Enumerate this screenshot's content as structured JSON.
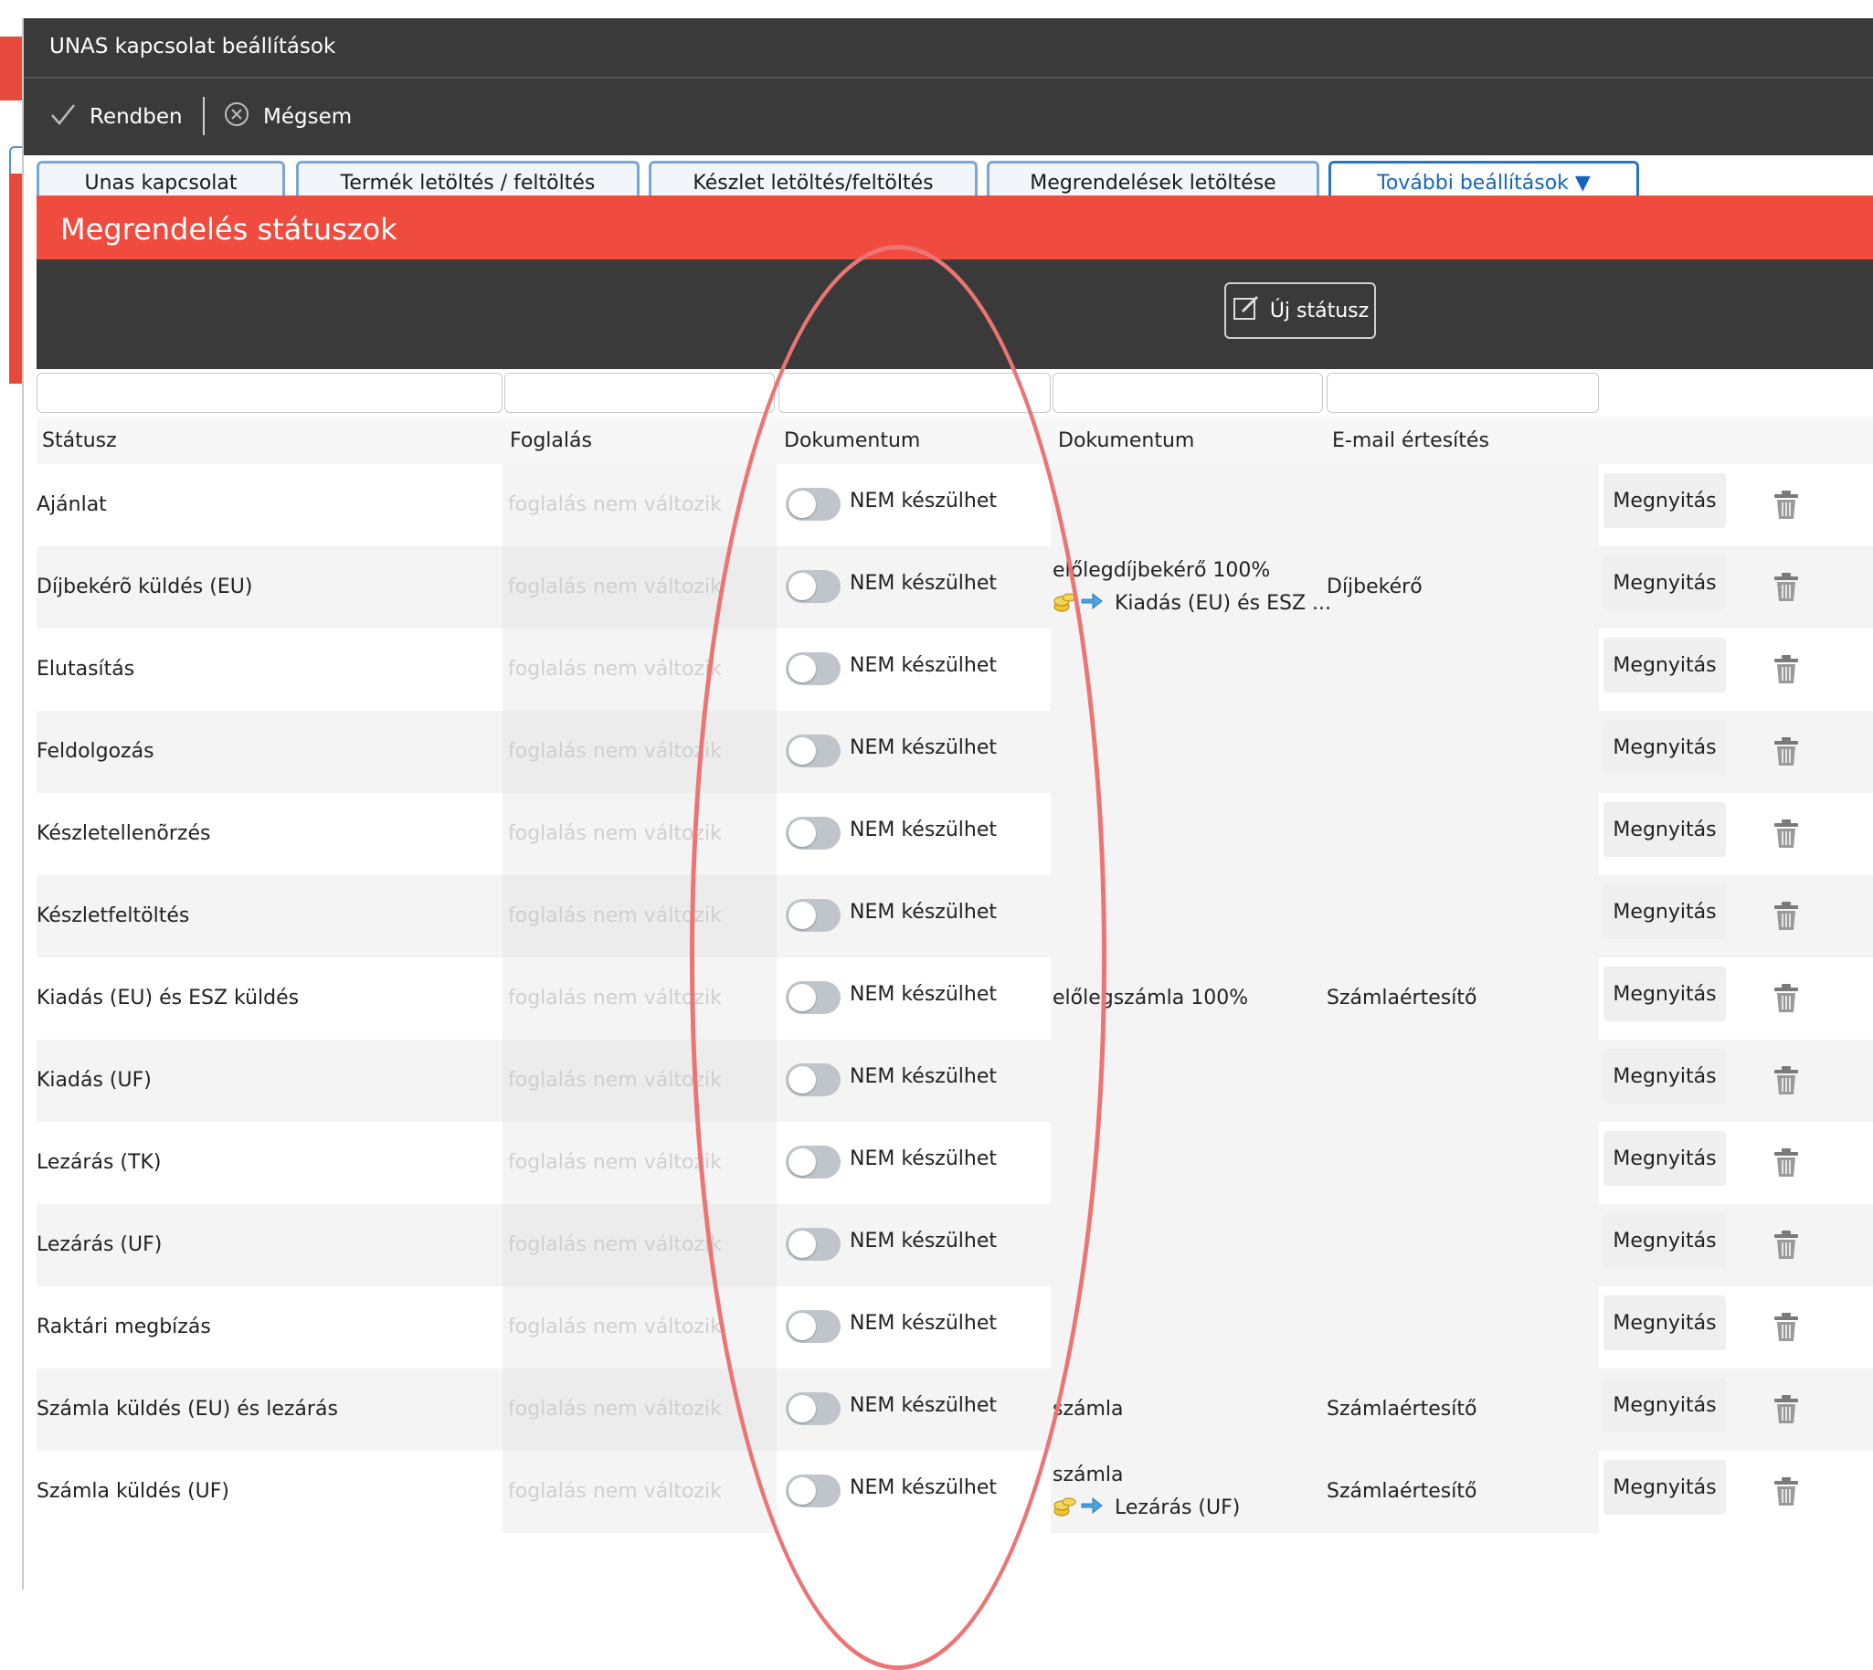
{
  "window": {
    "title": "UNAS kapcsolat beállítások"
  },
  "toolbar": {
    "ok_label": "Rendben",
    "cancel_label": "Mégsem"
  },
  "tabs": [
    {
      "label": "Unas kapcsolat"
    },
    {
      "label": "Termék letöltés / feltöltés"
    },
    {
      "label": "Készlet letöltés/feltöltés"
    },
    {
      "label": "Megrendelések letöltése"
    },
    {
      "label": "További beállítások ▼"
    }
  ],
  "section": {
    "title": "Megrendelés státuszok",
    "new_status_label": "Új státusz"
  },
  "columns": [
    "Státusz",
    "Foglalás",
    "Dokumentum",
    "Dokumentum",
    "E-mail értesítés"
  ],
  "rows": [
    {
      "status": "Ajánlat",
      "foglalas": "foglalás nem változik",
      "toggle": "NEM készülhet",
      "doc": "",
      "doc_next": "",
      "email": "",
      "open": "Megnyitás"
    },
    {
      "status": "Díjbekérõ küldés (EU)",
      "foglalas": "foglalás nem változik",
      "toggle": "NEM készülhet",
      "doc": "előlegdíjbekérő 100%",
      "doc_next": "Kiadás (EU) és ESZ ...",
      "email": "Díjbekérő",
      "open": "Megnyitás"
    },
    {
      "status": "Elutasítás",
      "foglalas": "foglalás nem változik",
      "toggle": "NEM készülhet",
      "doc": "",
      "doc_next": "",
      "email": "",
      "open": "Megnyitás"
    },
    {
      "status": "Feldolgozás",
      "foglalas": "foglalás nem változik",
      "toggle": "NEM készülhet",
      "doc": "",
      "doc_next": "",
      "email": "",
      "open": "Megnyitás"
    },
    {
      "status": "Készletellenõrzés",
      "foglalas": "foglalás nem változik",
      "toggle": "NEM készülhet",
      "doc": "",
      "doc_next": "",
      "email": "",
      "open": "Megnyitás"
    },
    {
      "status": "Készletfeltöltés",
      "foglalas": "foglalás nem változik",
      "toggle": "NEM készülhet",
      "doc": "",
      "doc_next": "",
      "email": "",
      "open": "Megnyitás"
    },
    {
      "status": "Kiadás (EU) és ESZ küldés",
      "foglalas": "foglalás nem változik",
      "toggle": "NEM készülhet",
      "doc": "előlegszámla 100%",
      "doc_next": "",
      "email": "Számlaértesítő",
      "open": "Megnyitás"
    },
    {
      "status": "Kiadás (UF)",
      "foglalas": "foglalás nem változik",
      "toggle": "NEM készülhet",
      "doc": "",
      "doc_next": "",
      "email": "",
      "open": "Megnyitás"
    },
    {
      "status": "Lezárás (TK)",
      "foglalas": "foglalás nem változik",
      "toggle": "NEM készülhet",
      "doc": "",
      "doc_next": "",
      "email": "",
      "open": "Megnyitás"
    },
    {
      "status": "Lezárás (UF)",
      "foglalas": "foglalás nem változik",
      "toggle": "NEM készülhet",
      "doc": "",
      "doc_next": "",
      "email": "",
      "open": "Megnyitás"
    },
    {
      "status": "Raktári megbízás",
      "foglalas": "foglalás nem változik",
      "toggle": "NEM készülhet",
      "doc": "",
      "doc_next": "",
      "email": "",
      "open": "Megnyitás"
    },
    {
      "status": "Számla küldés (EU) és lezárás",
      "foglalas": "foglalás nem változik",
      "toggle": "NEM készülhet",
      "doc": "számla",
      "doc_next": "",
      "email": "Számlaértesítő",
      "open": "Megnyitás"
    },
    {
      "status": "Számla küldés (UF)",
      "foglalas": "foglalás nem változik",
      "toggle": "NEM készülhet",
      "doc": "számla",
      "doc_next": "Lezárás (UF)",
      "email": "Számlaértesítő",
      "open": "Megnyitás"
    }
  ],
  "colors": {
    "accent_red": "#ef4c3f",
    "dark_bar": "#3a3a3a",
    "tab_border": "#7aa7d6",
    "active_tab_text": "#1565c0",
    "annotation": "#ec7474"
  }
}
